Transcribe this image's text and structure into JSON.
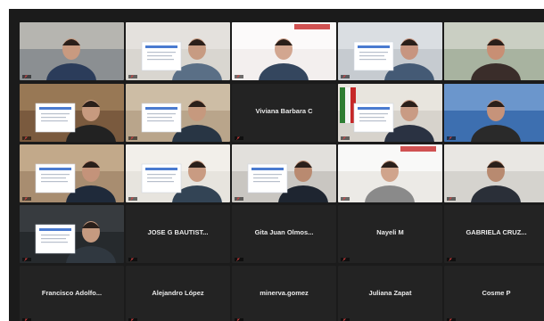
{
  "colors": {
    "grid_bg": "#1b1b1b",
    "tile_bg": "#232323",
    "active_speaker_border": "#e3d76b",
    "muted_icon": "#e04444",
    "name_text": "#e9e9e9"
  },
  "participants": [
    {
      "name": "",
      "tag": "",
      "video": true,
      "muted": true,
      "speaking": false
    },
    {
      "name": "",
      "tag": "",
      "video": true,
      "muted": true,
      "speaking": false
    },
    {
      "name": "",
      "tag": "",
      "video": true,
      "muted": true,
      "speaking": false
    },
    {
      "name": "",
      "tag": "",
      "video": true,
      "muted": true,
      "speaking": false
    },
    {
      "name": "",
      "tag": "",
      "video": true,
      "muted": false,
      "speaking": true
    },
    {
      "name": "",
      "tag": "",
      "video": true,
      "muted": true,
      "speaking": false
    },
    {
      "name": "",
      "tag": "",
      "video": true,
      "muted": true,
      "speaking": false
    },
    {
      "name": "Viviana Barbara C",
      "tag": "",
      "video": false,
      "muted": true,
      "speaking": false
    },
    {
      "name": "",
      "tag": "",
      "video": true,
      "muted": true,
      "speaking": false
    },
    {
      "name": "",
      "tag": "",
      "video": true,
      "muted": true,
      "speaking": false
    },
    {
      "name": "",
      "tag": "",
      "video": true,
      "muted": true,
      "speaking": false
    },
    {
      "name": "",
      "tag": "",
      "video": true,
      "muted": true,
      "speaking": false
    },
    {
      "name": "",
      "tag": "",
      "video": true,
      "muted": true,
      "speaking": false
    },
    {
      "name": "",
      "tag": "",
      "video": true,
      "muted": true,
      "speaking": false
    },
    {
      "name": "",
      "tag": "",
      "video": true,
      "muted": true,
      "speaking": false
    },
    {
      "name": "",
      "tag": "",
      "video": true,
      "muted": true,
      "speaking": false
    },
    {
      "name": "JOSE G BAUTIST...",
      "tag": "",
      "video": false,
      "muted": true,
      "speaking": false
    },
    {
      "name": "Gita Juan Olmos...",
      "tag": "",
      "video": false,
      "muted": true,
      "speaking": false
    },
    {
      "name": "Nayeli M",
      "tag": "",
      "video": false,
      "muted": true,
      "speaking": false
    },
    {
      "name": "GABRIELA CRUZ...",
      "tag": "",
      "video": false,
      "muted": true,
      "speaking": false
    },
    {
      "name": "Francisco Adolfo...",
      "tag": "",
      "video": false,
      "muted": true,
      "speaking": false
    },
    {
      "name": "Alejandro López",
      "tag": "",
      "video": false,
      "muted": true,
      "speaking": false
    },
    {
      "name": "minerva.gomez",
      "tag": "",
      "video": false,
      "muted": true,
      "speaking": false
    },
    {
      "name": "Juliana Zapat",
      "tag": "",
      "video": false,
      "muted": true,
      "speaking": false
    },
    {
      "name": "Cosme P",
      "tag": "",
      "video": false,
      "muted": true,
      "speaking": false
    }
  ]
}
